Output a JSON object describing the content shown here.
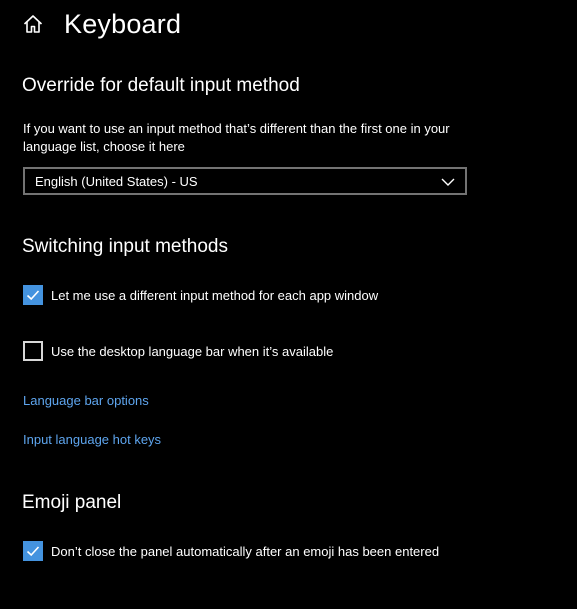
{
  "page": {
    "title": "Keyboard"
  },
  "override": {
    "heading": "Override for default input method",
    "description": "If you want to use an input method that’s different than the first one in your language list, choose it here",
    "selected_value": "English (United States) - US"
  },
  "switching": {
    "heading": "Switching input methods",
    "per_app": {
      "label": "Let me use a different input method for each app window",
      "checked": true
    },
    "language_bar": {
      "label": "Use the desktop language bar when it’s available",
      "checked": false
    },
    "links": {
      "language_bar_options": "Language bar options",
      "hot_keys": "Input language hot keys"
    }
  },
  "emoji": {
    "heading": "Emoji panel",
    "keep_open": {
      "label": "Don’t close the panel automatically after an emoji has been entered",
      "checked": true
    }
  },
  "colors": {
    "background": "#000000",
    "accent": "#4493df",
    "link": "#5ea5ee",
    "dropdown_border": "#737373"
  },
  "icons": {
    "home": "home-icon",
    "dropdown": "chevron-down-icon",
    "check": "checkmark-icon"
  }
}
